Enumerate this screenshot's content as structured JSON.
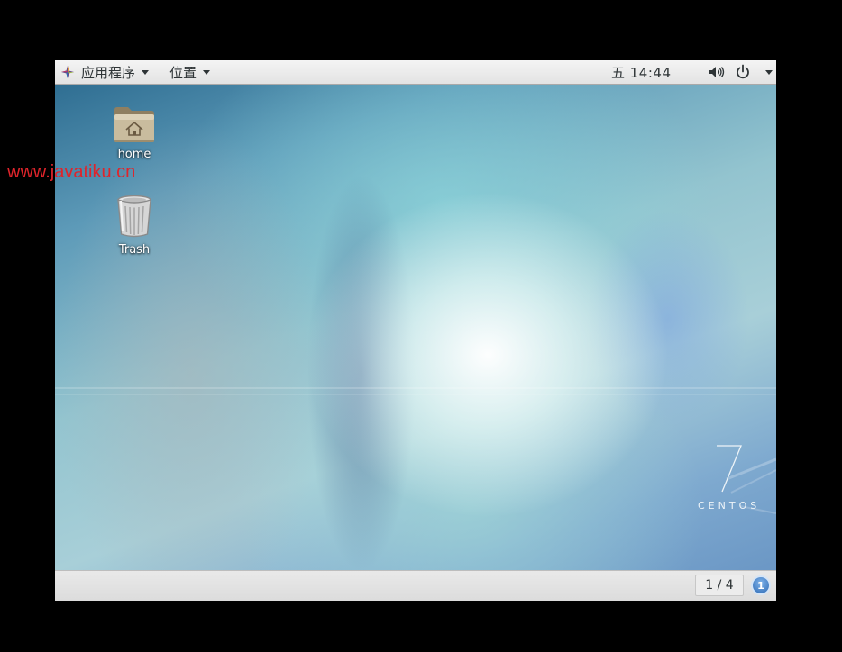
{
  "top_panel": {
    "apps_menu_label": "应用程序",
    "places_menu_label": "位置",
    "clock": "五 14:44",
    "icons": [
      "system-logo-icon",
      "volume-icon",
      "power-icon",
      "chevron-down-icon"
    ]
  },
  "desktop": {
    "icons": [
      {
        "label": "home",
        "icon": "home-folder-icon"
      },
      {
        "label": "Trash",
        "icon": "trash-icon"
      }
    ],
    "logo": {
      "number": "7",
      "text": "CENTOS"
    }
  },
  "bottom_panel": {
    "workspace_count": "1 / 4",
    "workspace_button": "1"
  },
  "watermark": "www.javatiku.cn",
  "colors": {
    "accent": "#2d69b3",
    "watermark": "#e0242b",
    "panel": "#e6e6e6"
  }
}
